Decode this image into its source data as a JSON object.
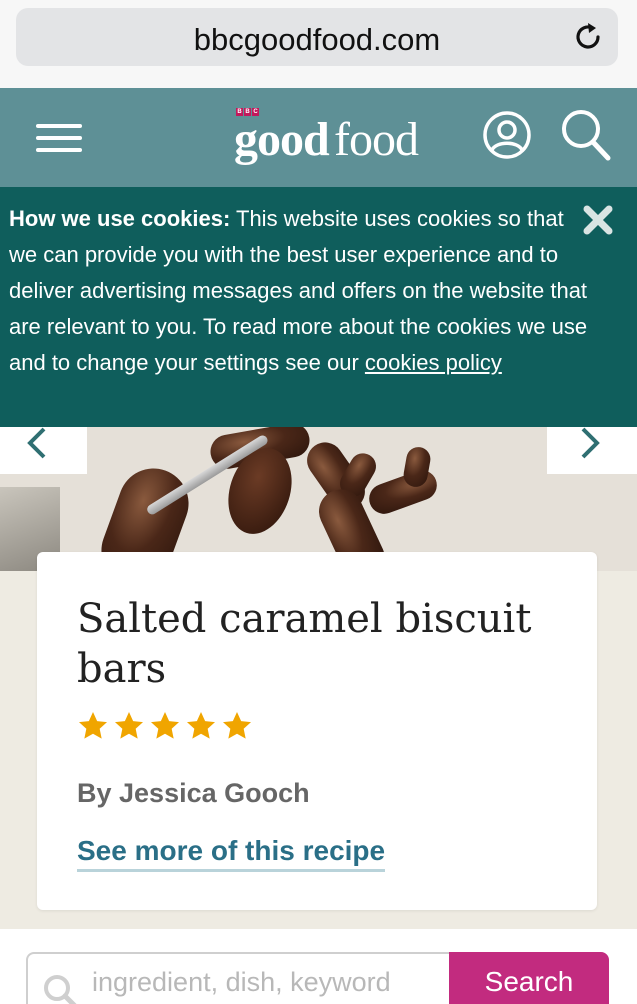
{
  "browser": {
    "url": "bbcgoodfood.com",
    "reload_icon": "reload-icon"
  },
  "header": {
    "logo_bbc": "BBC",
    "logo_good": "good",
    "logo_food": "food",
    "menu_icon": "hamburger-menu-icon",
    "account_icon": "account-icon",
    "search_icon": "search-icon",
    "background_color": "#5e9096"
  },
  "cookie_banner": {
    "heading": "How we use cookies:",
    "body": " This website uses cookies so that we can provide you with the best user experience and to deliver advertising messages and offers on the website that are relevant to you. To read more about the cookies we use and to change your settings see our ",
    "link_label": "cookies policy",
    "close_icon": "close-icon",
    "background_color": "#0f5e5c"
  },
  "carousel": {
    "prev_icon": "chevron-left-icon",
    "next_icon": "chevron-right-icon"
  },
  "recipe_card": {
    "title": "Salted caramel biscuit bars",
    "rating": 5,
    "rating_max": 5,
    "star_color": "#f0a500",
    "author": "By Jessica Gooch",
    "see_more_label": "See more of this recipe",
    "link_color": "#2a6f87"
  },
  "search": {
    "placeholder": "ingredient, dish, keyword",
    "value": "",
    "button_label": "Search",
    "button_color": "#c22b7f"
  }
}
